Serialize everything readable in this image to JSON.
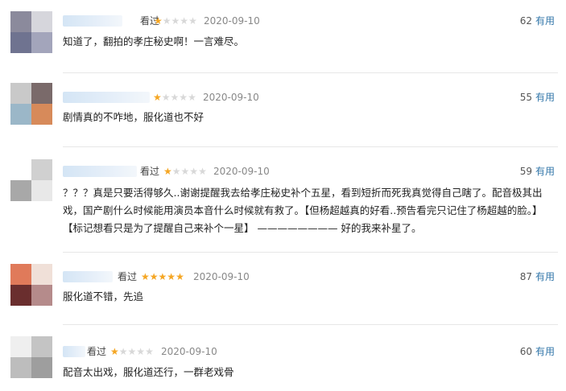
{
  "reviews": [
    {
      "seen": "看过",
      "stars": {
        "on": 1,
        "total": 5
      },
      "date": "2020-09-10",
      "votes": "62",
      "useful": "有用",
      "content": "知道了，翻拍的孝庄秘史啊！一言难尽。"
    },
    {
      "seen": "",
      "stars": {
        "on": 1,
        "total": 5
      },
      "date": "2020-09-10",
      "votes": "55",
      "useful": "有用",
      "content": "剧情真的不咋地，服化道也不好"
    },
    {
      "seen": "看过",
      "stars": {
        "on": 1,
        "total": 5
      },
      "date": "2020-09-10",
      "votes": "59",
      "useful": "有用",
      "content": "？？？真是只要活得够久..谢谢提醒我去给孝庄秘史补个五星，看到短折而死我真觉得自己瞎了。配音极其出戏，国产剧什么时候能用演员本音什么时候就有救了。【但杨超越真的好看..预告看完只记住了杨超越的脸。】【标记想看只是为了提醒自己来补个一星】 ———————— 好的我来补星了。"
    },
    {
      "seen": "看过",
      "stars": {
        "on": 5,
        "total": 5
      },
      "date": "2020-09-10",
      "votes": "87",
      "useful": "有用",
      "content": "服化道不错，先追"
    },
    {
      "seen": "看过",
      "stars": {
        "on": 1,
        "total": 5
      },
      "date": "2020-09-10",
      "votes": "60",
      "useful": "有用",
      "content": "配音太出戏，服化道还行，一群老戏骨"
    }
  ],
  "colors": {
    "star_on": "#f5a623",
    "star_off": "#d8d8d8",
    "useful_link": "#3377aa",
    "date": "#888888"
  }
}
